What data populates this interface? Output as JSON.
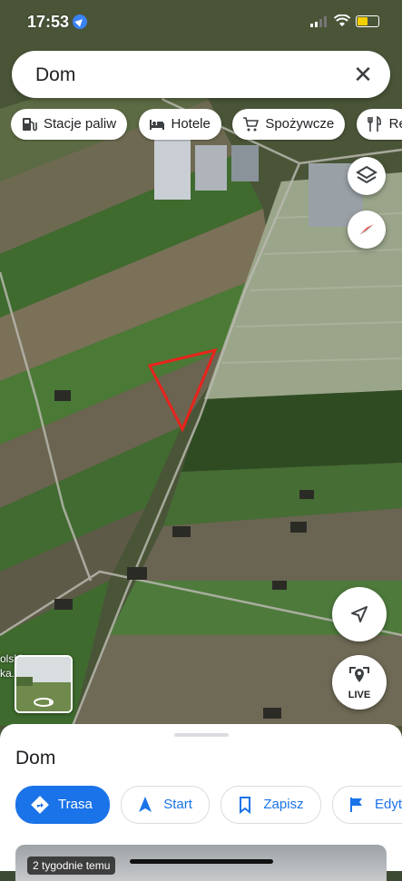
{
  "status_bar": {
    "time": "17:53",
    "battery_color": "#f5d000"
  },
  "search": {
    "query": "Dom",
    "close_icon": "close-icon"
  },
  "chips": [
    {
      "label": "Stacje paliw",
      "icon": "gas-station-icon"
    },
    {
      "label": "Hotele",
      "icon": "bed-icon"
    },
    {
      "label": "Spożywcze",
      "icon": "shopping-cart-icon"
    },
    {
      "label": "Re",
      "icon": "restaurant-icon"
    }
  ],
  "map": {
    "marked_area_color": "#e8231c",
    "street_view_label": "olski\nka..",
    "live_label": "LIVE"
  },
  "place_sheet": {
    "title": "Dom",
    "actions": [
      {
        "label": "Trasa",
        "icon": "directions-icon",
        "primary": true
      },
      {
        "label": "Start",
        "icon": "navigation-arrow-icon",
        "primary": false
      },
      {
        "label": "Zapisz",
        "icon": "bookmark-icon",
        "primary": false
      },
      {
        "label": "Edytu",
        "icon": "flag-icon",
        "primary": false
      }
    ],
    "photo_badge": "2 tygodnie temu"
  },
  "colors": {
    "accent": "#1a73e8"
  }
}
